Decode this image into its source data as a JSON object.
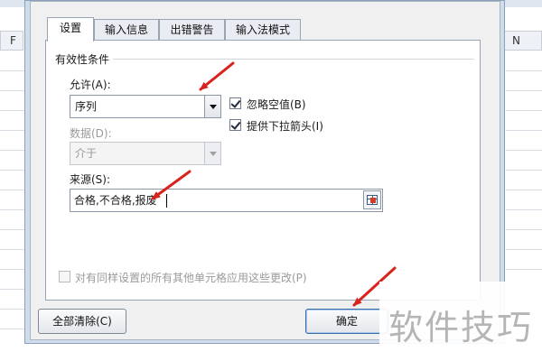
{
  "sheet": {
    "col_left": "F",
    "col_right": "N"
  },
  "dialog": {
    "tabs": [
      {
        "label": "设置"
      },
      {
        "label": "输入信息"
      },
      {
        "label": "出错警告"
      },
      {
        "label": "输入法模式"
      }
    ],
    "group_label": "有效性条件",
    "allow_label": "允许(A):",
    "allow_value": "序列",
    "data_label": "数据(D):",
    "data_value": "介于",
    "ignore_blank_label": "忽略空值(B)",
    "dropdown_arrow_label": "提供下拉箭头(I)",
    "source_label": "来源(S):",
    "source_value": "合格,不合格,报废",
    "apply_all_label": "对有同样设置的所有其他单元格应用这些更改(P)",
    "clear_all_button": "全部清除(C)",
    "ok_button": "确定"
  },
  "watermark": "软件技巧",
  "colors": {
    "arrow": "#d9231d"
  }
}
